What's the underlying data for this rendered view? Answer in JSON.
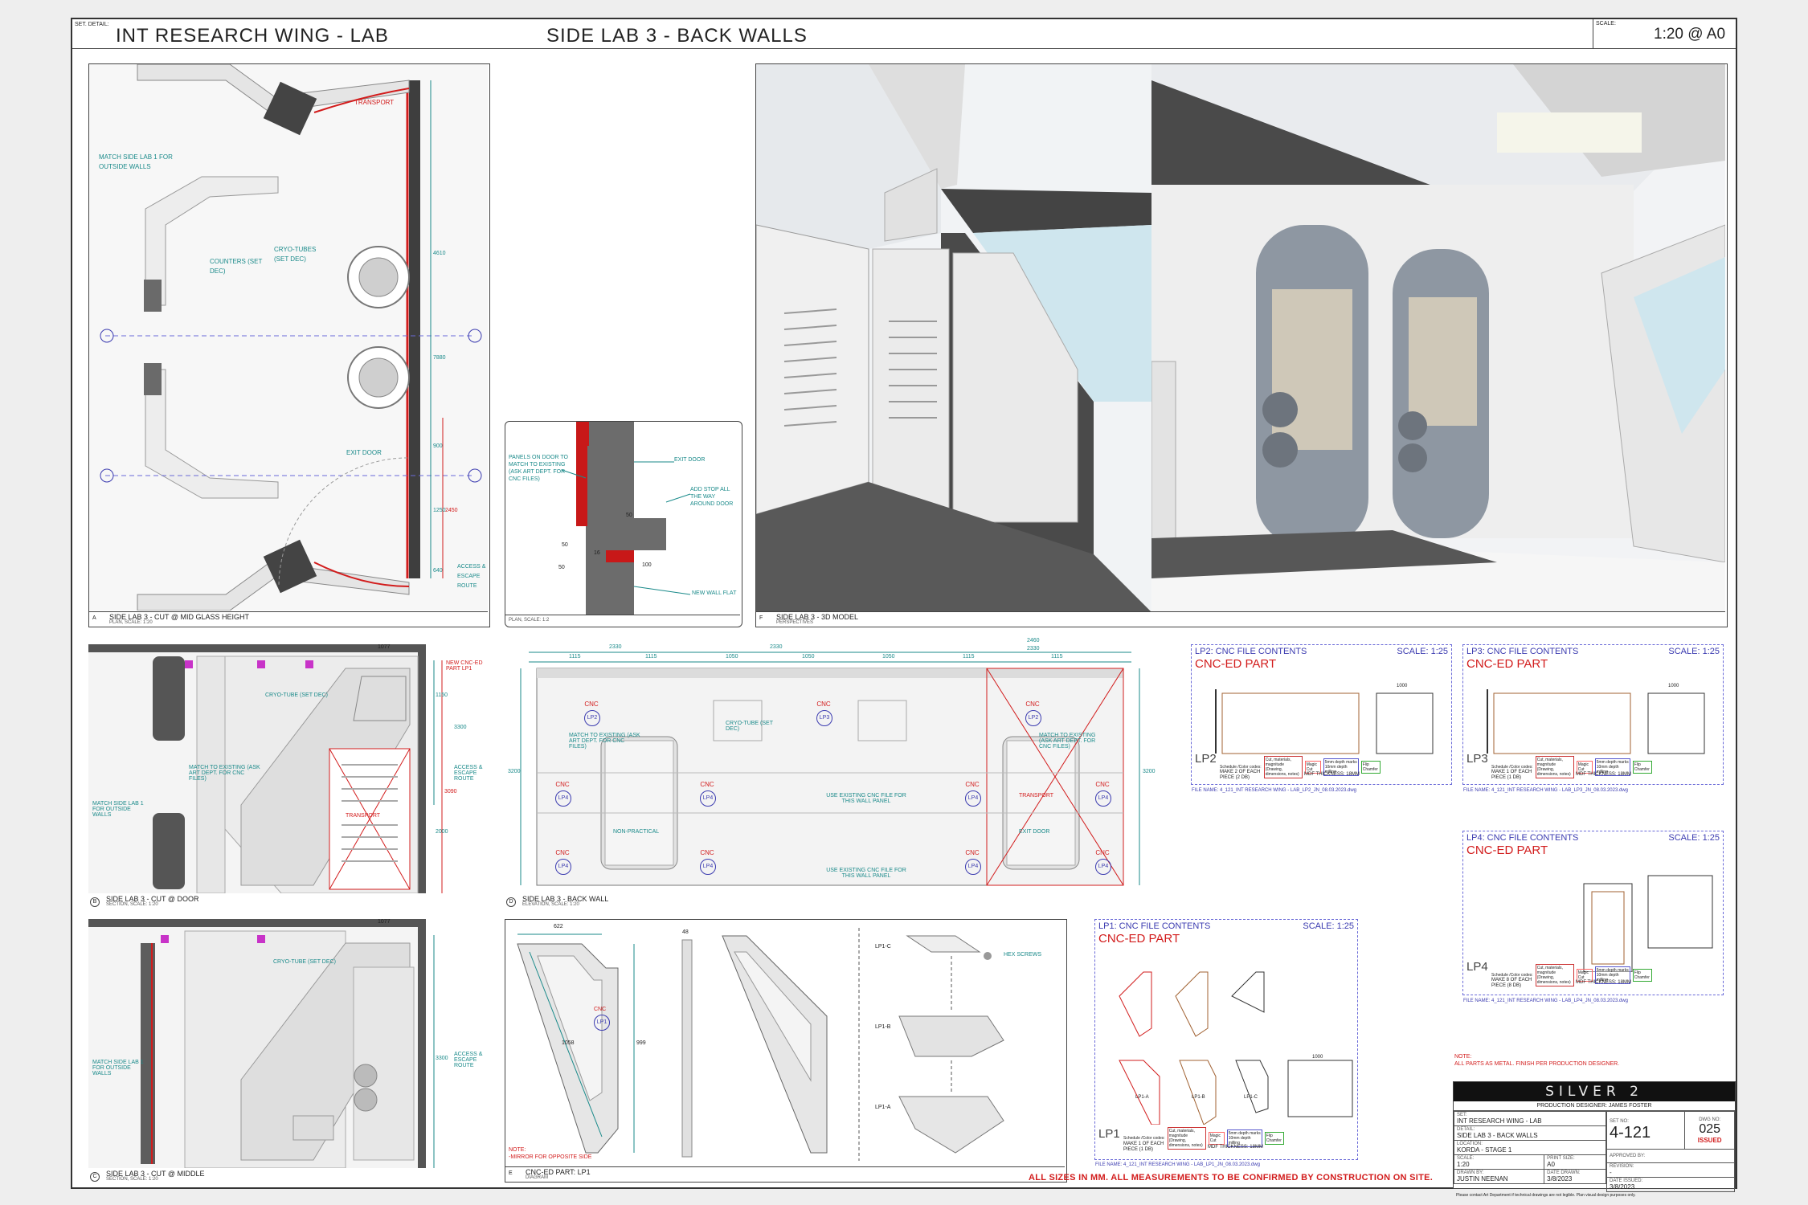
{
  "header": {
    "set_detail_label": "SET. DETAIL:",
    "set_title": "INT RESEARCH WING - LAB",
    "sheet_title": "SIDE LAB 3 - BACK WALLS",
    "scale_label": "SCALE:",
    "scale_value": "1:20 @ A0"
  },
  "plan": {
    "letter": "A",
    "title": "SIDE LAB 3 - CUT @ MID GLASS HEIGHT",
    "subtitle": "PLAN, SCALE: 1:20",
    "notes": {
      "match_side_lab1": "MATCH SIDE LAB 1 FOR OUTSIDE WALLS",
      "counters": "COUNTERS (SET DEC)",
      "cryo_tubes": "CRYO-TUBES (SET DEC)",
      "exit_door": "EXIT DOOR",
      "transport": "TRANSPORT",
      "access_route": "ACCESS & ESCAPE ROUTE"
    },
    "dims": [
      "4610",
      "7880",
      "900",
      "1250",
      "2450",
      "640"
    ]
  },
  "detail": {
    "subtitle": "PLAN, SCALE: 1:2",
    "notes": {
      "panels_on_door": "PANELS ON DOOR TO MATCH TO EXISTING (ASK ART DEPT. FOR CNC FILES)",
      "exit_door": "EXIT DOOR",
      "add_stop": "ADD STOP ALL THE WAY AROUND DOOR",
      "new_wall_flat": "NEW WALL FLAT"
    },
    "dims": [
      "50",
      "50",
      "100",
      "16",
      "50"
    ]
  },
  "model": {
    "letter": "F",
    "title": "SIDE LAB 3 - 3D MODEL",
    "subtitle": "PERSPECTIVES"
  },
  "section_door": {
    "letter": "B",
    "title": "SIDE LAB 3 - CUT @ DOOR",
    "subtitle": "SECTION, SCALE: 1:20",
    "notes": {
      "new_cnc_part": "NEW CNC-ED PART LP1",
      "cryo_tube": "CRYO-TUBE (SET DEC)",
      "match_existing": "MATCH TO EXISTING (ASK ART DEPT. FOR CNC FILES)",
      "match_side_lab1": "MATCH SIDE LAB 1 FOR OUTSIDE WALLS",
      "access_route": "ACCESS & ESCAPE ROUTE",
      "transport": "TRANSPORT"
    },
    "dims": [
      "1077",
      "1150",
      "3090",
      "2000",
      "3300"
    ]
  },
  "section_middle": {
    "letter": "C",
    "title": "SIDE LAB 3 - CUT @ MIDDLE",
    "subtitle": "SECTION, SCALE: 1:20",
    "notes": {
      "cryo_tube": "CRYO-TUBE (SET DEC)",
      "match_side_lab1": "MATCH SIDE LAB 1 FOR OUTSIDE WALLS",
      "access_route": "ACCESS & ESCAPE ROUTE"
    },
    "dims": [
      "1077",
      "3300"
    ]
  },
  "elevation": {
    "letter": "D",
    "title": "SIDE LAB 3 - BACK WALL",
    "subtitle": "ELEVATION, SCALE: 1:20",
    "top_dims": [
      "2330",
      "2330",
      "2460",
      "2330"
    ],
    "sub_dims": [
      "1115",
      "1115",
      "1050",
      "1050",
      "1050",
      "1115",
      "1115"
    ],
    "side_dims": [
      "3200",
      "3200"
    ],
    "notes": {
      "cryo_tube": "CRYO-TUBE (SET DEC)",
      "match_existing": "MATCH TO EXISTING (ASK ART DEPT. FOR CNC FILES)",
      "match_existing_2": "MATCH TO EXISTING (ASK ART DEPT. FOR CNC FILES)",
      "use_existing_1": "USE EXISTING CNC FILE FOR THIS WALL PANEL",
      "use_existing_2": "USE EXISTING CNC FILE FOR THIS WALL PANEL",
      "non_practical": "NON-PRACTICAL",
      "transport": "TRANSPORT",
      "exit_door": "EXIT DOOR"
    },
    "cnc_word": "CNC",
    "cnc_labels": [
      "LP2",
      "LP3",
      "LP2",
      "LP4",
      "LP4",
      "LP4",
      "LP4",
      "LP4",
      "LP4",
      "LP4",
      "LP4"
    ]
  },
  "diagram": {
    "letter": "E",
    "title": "CNC-ED PART: LP1",
    "subtitle": "DIAGRAM",
    "note_title": "NOTE:",
    "note_text": "-MIRROR FOR OPPOSITE SIDE",
    "hex_screws": "HEX SCREWS",
    "cnc": "CNC",
    "cnc_id": "LP1",
    "parts": [
      "LP1-C",
      "LP1-B",
      "LP1-A"
    ],
    "dims": [
      "622",
      "48",
      "1058",
      "999"
    ]
  },
  "cnc_sheets": [
    {
      "id": "lp2",
      "title": "LP2: CNC FILE CONTENTS",
      "scale": "SCALE: 1:25",
      "heading": "CNC-ED PART",
      "code": "LP2",
      "make": "MAKE 2 OF EACH PIECE (2 DB)",
      "thickness": "MDF THICKNESS: 18MM",
      "filename": "FILE NAME: 4_121_INT RESEARCH WING - LAB_LP2_JN_08.03.2023.dwg"
    },
    {
      "id": "lp3",
      "title": "LP3: CNC FILE CONTENTS",
      "scale": "SCALE: 1:25",
      "heading": "CNC-ED PART",
      "code": "LP3",
      "make": "MAKE 1 OF EACH PIECE (1 DB)",
      "thickness": "MDF THICKNESS: 18MM",
      "filename": "FILE NAME: 4_121_INT RESEARCH WING - LAB_LP3_JN_08.03.2023.dwg"
    },
    {
      "id": "lp4",
      "title": "LP4: CNC FILE CONTENTS",
      "scale": "SCALE: 1:25",
      "heading": "CNC-ED PART",
      "code": "LP4",
      "make": "MAKE 8 OF EACH PIECE (8 DB)",
      "thickness": "MDF THICKNESS: 18MM",
      "filename": "FILE NAME: 4_121_INT RESEARCH WING - LAB_LP4_JN_08.03.2023.dwg"
    },
    {
      "id": "lp1",
      "title": "LP1: CNC FILE CONTENTS",
      "scale": "SCALE: 1:25",
      "heading": "CNC-ED PART",
      "code": "LP1",
      "make": "MAKE 1 OF EACH PIECE (1 DB)",
      "thickness": "MDF THICKNESS: 18MM",
      "filename": "FILE NAME: 4_121_INT RESEARCH WING - LAB_LP1_JN_08.03.2023.dwg",
      "parts": [
        "LP1-A",
        "LP1-B",
        "LP1-C"
      ]
    }
  ],
  "legend": {
    "label": "Schedule /Color codes:",
    "items": [
      "Cut, materials, magnitude (Drawing, dimensions, notes)",
      "Magic Cut",
      "5mm depth marks 10mm depth milling",
      "Flip Chamfer"
    ],
    "colors": [
      "#cc3333",
      "#ff6666",
      "#5555cc",
      "#33aa33"
    ]
  },
  "dim_1000": "1000",
  "note_metal": {
    "title": "NOTE:",
    "text": "ALL PARTS AS METAL. FINISH PER PRODUCTION DESIGNER."
  },
  "bottom_note": "ALL SIZES IN MM. ALL MEASUREMENTS TO BE CONFIRMED BY CONSTRUCTION ON SITE.",
  "title_block": {
    "logo": "SILVER 2",
    "production_designer": "PRODUCTION DESIGNER: JAMES FOSTER",
    "set_label": "SET:",
    "set_value": "INT RESEARCH WING - LAB",
    "detail_label": "DETAIL:",
    "detail_value": "SIDE LAB 3 - BACK WALLS",
    "location_label": "LOCATION:",
    "location_value": "KORDA - STAGE 1",
    "scale_label": "SCALE:",
    "scale_value": "1:20",
    "print_size_label": "PRINT SIZE:",
    "print_size_value": "A0",
    "drawn_by_label": "DRAWN BY:",
    "drawn_by_value": "JUSTIN NEENAN",
    "date_drawn_label": "DATE DRAWN:",
    "date_drawn_value": "3/8/2023",
    "set_no_label": "SET NO:",
    "set_no_value": "4-121",
    "sheet_no_label": "DWG NO:",
    "sheet_no_value": "025",
    "status": "ISSUED",
    "approved_label": "APPROVED BY:",
    "revision_label": "REVISION:",
    "revision_value": "-",
    "date_issued_label": "DATE ISSUED:",
    "date_issued_value": "3/8/2023",
    "footer": "Please contact Art Department if technical drawings are not legible. Plan visual design purposes only."
  },
  "colors": {
    "teal": "#1a8a8a",
    "red": "#d21c1c",
    "blue": "#3b3bb0",
    "wall_dark": "#4a4a4a",
    "panel_light": "#eaeaea"
  }
}
